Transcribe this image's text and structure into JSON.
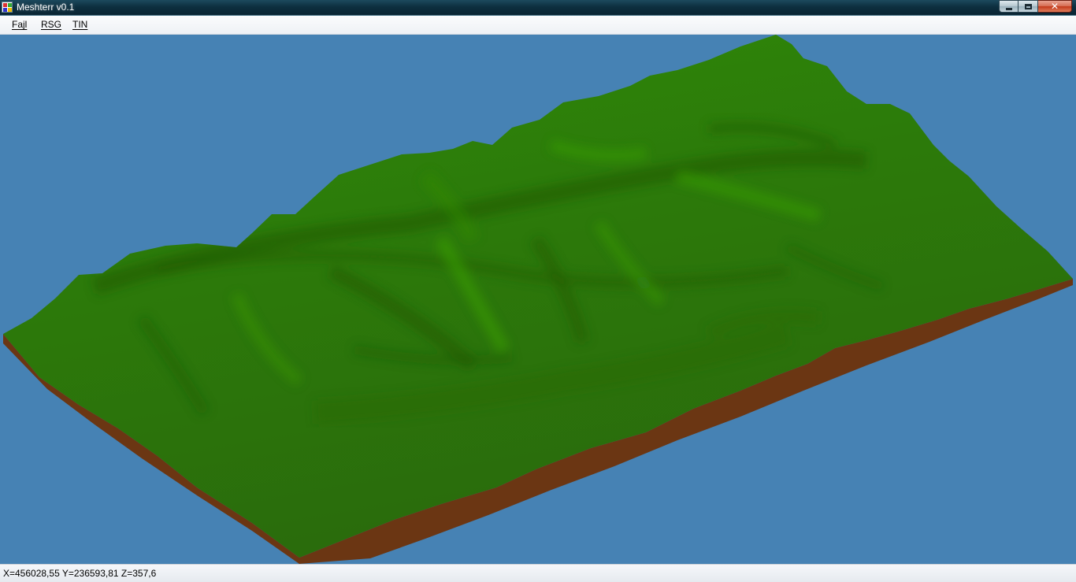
{
  "window": {
    "title": "Meshterr v0.1",
    "icon": "app-grid-icon",
    "close_glyph": "✕"
  },
  "menu": {
    "items": [
      {
        "label": "Fajl"
      },
      {
        "label": "RSG"
      },
      {
        "label": "TIN"
      }
    ]
  },
  "viewport": {
    "background_color": "#4682b4",
    "terrain_color": "#2f7d0a",
    "base_color": "#6b3613"
  },
  "status": {
    "coordinates": "X=456028,55 Y=236593,81 Z=357,6"
  }
}
